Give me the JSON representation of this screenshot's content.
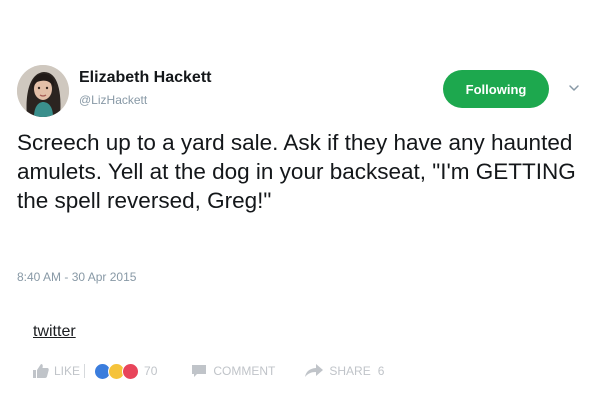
{
  "user": {
    "name": "Elizabeth Hackett",
    "handle": "@LizHackett"
  },
  "follow_button_label": "Following",
  "tweet_text": "Screech up to a yard sale.  Ask if they have any haunted amulets.  Yell at the dog in your backseat, \"I'm GETTING the spell reversed, Greg!\"",
  "timestamp": "8:40 AM - 30 Apr 2015",
  "source_label": "twitter",
  "actions": {
    "like_label": "LIKE",
    "reaction_count": "70",
    "comment_label": "COMMENT",
    "share_label": "SHARE",
    "share_count": "6"
  },
  "colors": {
    "follow_green": "#1da84e",
    "muted_text": "#8899a6",
    "like_blue": "#3b7ddd",
    "love_red": "#e8455b",
    "haha_yellow": "#f5c33b"
  },
  "icons": [
    "avatar",
    "chevron-down-icon",
    "like-icon",
    "like-reaction-icon",
    "haha-reaction-icon",
    "love-reaction-icon",
    "comment-icon",
    "share-icon"
  ]
}
